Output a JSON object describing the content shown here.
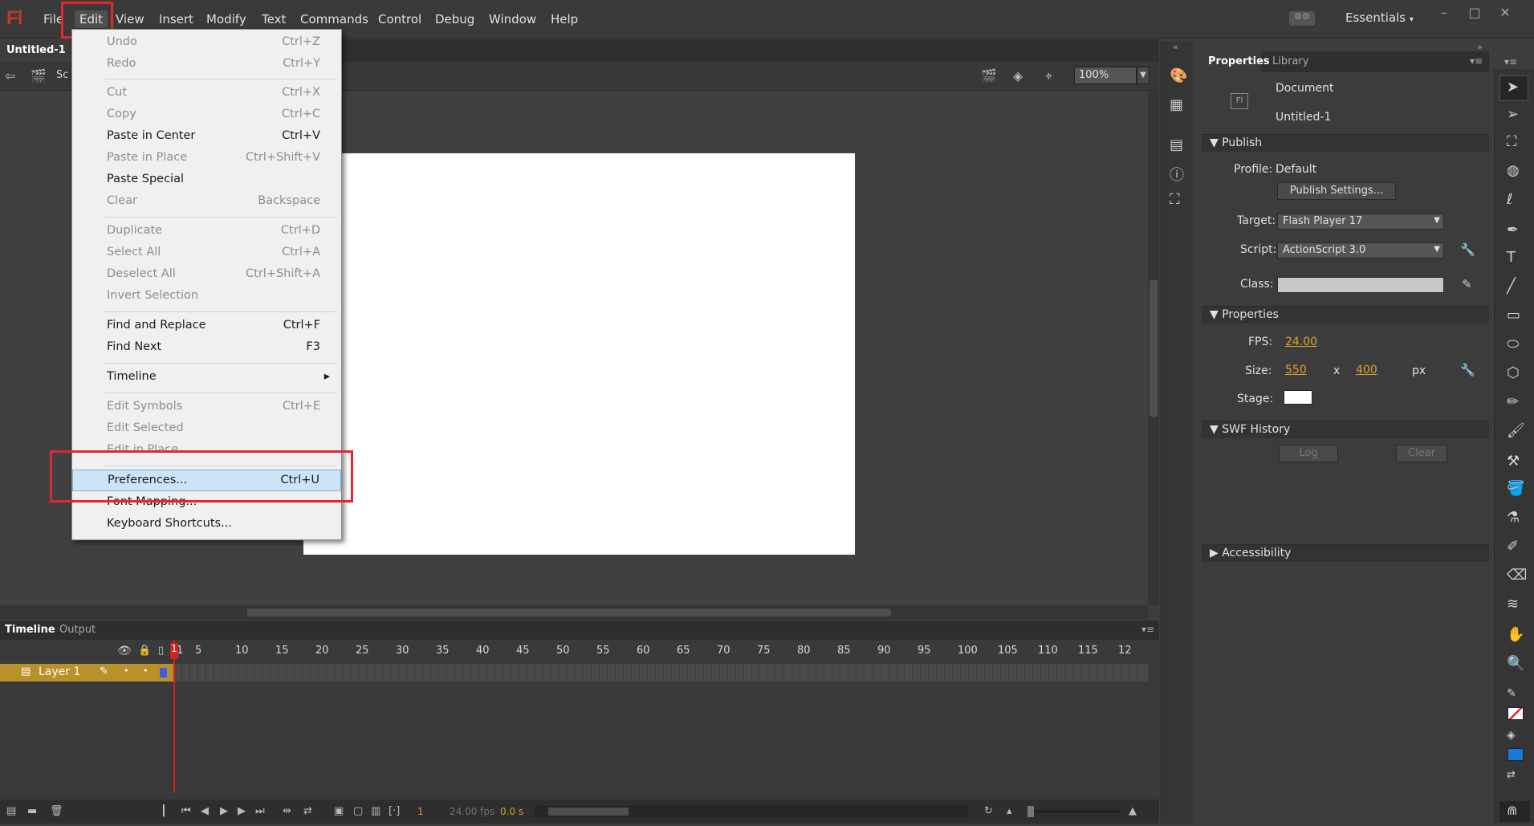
{
  "app": {
    "logo": "Fl",
    "workspace": "Essentials"
  },
  "menubar": [
    "File",
    "Edit",
    "View",
    "Insert",
    "Modify",
    "Text",
    "Commands",
    "Control",
    "Debug",
    "Window",
    "Help"
  ],
  "document": {
    "tab": "Untitled-1",
    "scene": "Sc",
    "zoom": "100%"
  },
  "edit_menu": {
    "items": [
      {
        "label": "Undo",
        "shortcut": "Ctrl+Z",
        "enabled": false
      },
      {
        "label": "Redo",
        "shortcut": "Ctrl+Y",
        "enabled": false
      },
      {
        "label": "Cut",
        "shortcut": "Ctrl+X",
        "enabled": false
      },
      {
        "label": "Copy",
        "shortcut": "Ctrl+C",
        "enabled": false
      },
      {
        "label": "Paste in Center",
        "shortcut": "Ctrl+V",
        "enabled": true
      },
      {
        "label": "Paste in Place",
        "shortcut": "Ctrl+Shift+V",
        "enabled": false
      },
      {
        "label": "Paste Special",
        "shortcut": "",
        "enabled": true
      },
      {
        "label": "Clear",
        "shortcut": "Backspace",
        "enabled": false
      },
      {
        "label": "Duplicate",
        "shortcut": "Ctrl+D",
        "enabled": false
      },
      {
        "label": "Select All",
        "shortcut": "Ctrl+A",
        "enabled": false
      },
      {
        "label": "Deselect All",
        "shortcut": "Ctrl+Shift+A",
        "enabled": false
      },
      {
        "label": "Invert Selection",
        "shortcut": "",
        "enabled": false
      },
      {
        "label": "Find and Replace",
        "shortcut": "Ctrl+F",
        "enabled": true
      },
      {
        "label": "Find Next",
        "shortcut": "F3",
        "enabled": true
      },
      {
        "label": "Timeline",
        "shortcut": "▸",
        "enabled": true
      },
      {
        "label": "Edit Symbols",
        "shortcut": "Ctrl+E",
        "enabled": false
      },
      {
        "label": "Edit Selected",
        "shortcut": "",
        "enabled": false
      },
      {
        "label": "Edit in Place",
        "shortcut": "",
        "enabled": false
      },
      {
        "label": "Preferences...",
        "shortcut": "Ctrl+U",
        "enabled": true
      },
      {
        "label": "Font Mapping...",
        "shortcut": "",
        "enabled": true
      },
      {
        "label": "Keyboard Shortcuts...",
        "shortcut": "",
        "enabled": true
      }
    ]
  },
  "timeline": {
    "tabs": [
      "Timeline",
      "Output"
    ],
    "ticks": [
      "1",
      "5",
      "10",
      "15",
      "20",
      "25",
      "30",
      "35",
      "40",
      "45",
      "50",
      "55",
      "60",
      "65",
      "70",
      "75",
      "80",
      "85",
      "90",
      "95",
      "100",
      "105",
      "110",
      "115",
      "12"
    ],
    "layer": "Layer 1",
    "current_frame": "1",
    "fps": "24.00 fps",
    "time": "0.0 s"
  },
  "properties": {
    "tabs": [
      "Properties",
      "Library"
    ],
    "doc_type": "Document",
    "doc_name": "Untitled-1",
    "publish": {
      "header": "Publish",
      "profile_label": "Profile:",
      "profile": "Default",
      "settings_button": "Publish Settings...",
      "target_label": "Target:",
      "target": "Flash Player 17",
      "script_label": "Script:",
      "script": "ActionScript 3.0",
      "class_label": "Class:"
    },
    "props": {
      "header": "Properties",
      "fps_label": "FPS:",
      "fps": "24.00",
      "size_label": "Size:",
      "width": "550",
      "x": "x",
      "height": "400",
      "unit": "px",
      "stage_label": "Stage:"
    },
    "swf": {
      "header": "SWF History",
      "log": "Log",
      "clear": "Clear"
    },
    "accessibility": "Accessibility"
  },
  "colors": {
    "stage": "#ffffff",
    "fill": "#1a78d6",
    "accent_red": "#e32636"
  }
}
